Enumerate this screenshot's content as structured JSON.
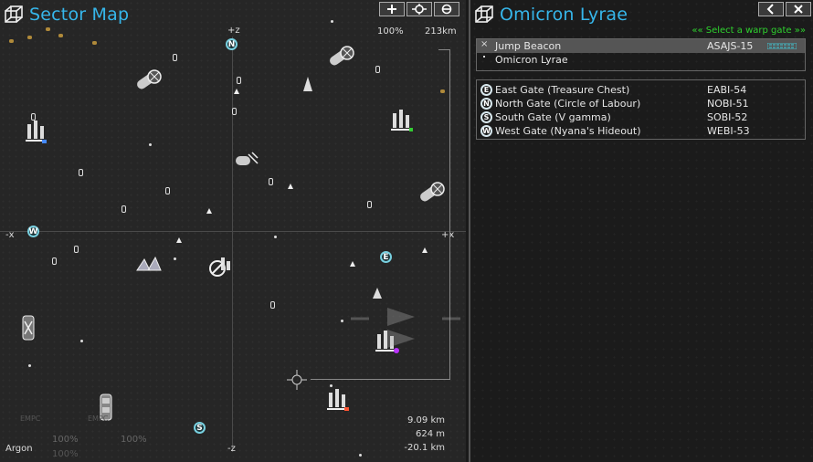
{
  "left_panel": {
    "title": "Sector Map",
    "zoom": "100%",
    "range": "213km",
    "axis_labels": {
      "top": "+z",
      "bottom": "-z",
      "left": "-x",
      "right": "+x"
    },
    "sector_owner": "Argon",
    "coords": {
      "line1": "9.09 km",
      "line2": "624 m",
      "line3": "-20.1 km"
    },
    "gates": {
      "north": "N",
      "west": "W",
      "east": "E",
      "south": "S"
    },
    "faded": {
      "label1": "EMPC",
      "label2": "EMPC",
      "pct1": "100%",
      "pct2": "100%",
      "pct3": "100%"
    },
    "buttons": {
      "zoom_in": "plus-icon",
      "center": "target-icon",
      "toggle": "filter-icon"
    }
  },
  "right_panel": {
    "title": "Omicron Lyrae",
    "hint": "«« Select a warp gate »»",
    "buttons": {
      "back": "chevron-left-icon",
      "close": "close-icon"
    },
    "list1": [
      {
        "name": "Jump Beacon",
        "code": "ASAJS-15",
        "icon": "x-icon",
        "selected": true
      },
      {
        "name": "Omicron Lyrae",
        "code": "",
        "icon": "dot-icon",
        "selected": false
      }
    ],
    "gates": [
      {
        "letter": "E",
        "name": "East Gate (Treasure Chest)",
        "code": "EABI-54"
      },
      {
        "letter": "N",
        "name": "North Gate (Circle of Labour)",
        "code": "NOBI-51"
      },
      {
        "letter": "S",
        "name": "South Gate (V gamma)",
        "code": "SOBI-52"
      },
      {
        "letter": "W",
        "name": "West Gate (Nyana's Hideout)",
        "code": "WEBI-53"
      }
    ]
  },
  "colors": {
    "title": "#36b6ea",
    "hint": "#2ed12e",
    "gate_ring": "#78d0e0",
    "bar": "#3fd0e0"
  }
}
